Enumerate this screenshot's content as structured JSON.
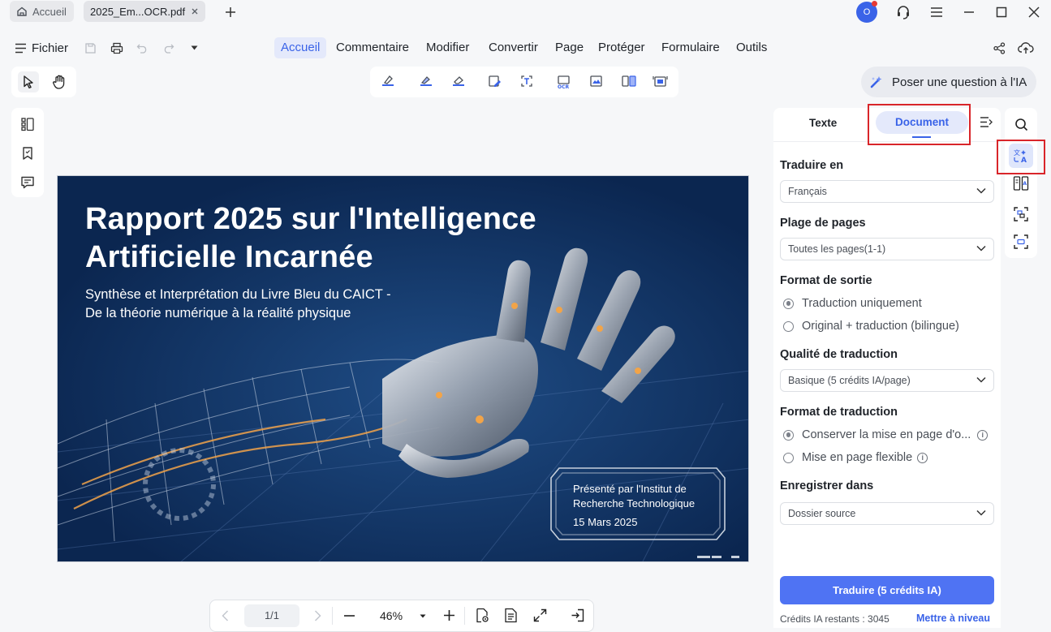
{
  "tabs": {
    "home_label": "Accueil",
    "doc_label": "2025_Em...OCR.pdf"
  },
  "titlebar": {
    "avatar_letter": "O",
    "accent": "#3a63e8"
  },
  "menubar": {
    "file_label": "Fichier",
    "items": [
      "Accueil",
      "Commentaire",
      "Modifier",
      "Convertir",
      "Page",
      "Protéger",
      "Formulaire",
      "Outils"
    ]
  },
  "ai": {
    "ask_label": "Poser une question à l'IA"
  },
  "document": {
    "title_line1": "Rapport 2025 sur l'Intelligence",
    "title_line2": "Artificielle Incarnée",
    "subtitle_line1": "Synthèse et Interprétation du Livre Bleu du CAICT -",
    "subtitle_line2": "De la théorie numérique à la réalité physique",
    "credit_line1": "Présenté par l'Institut de",
    "credit_line2": "Recherche Technologique",
    "credit_date": "15 Mars 2025"
  },
  "panel": {
    "tab_text": "Texte",
    "tab_document": "Document",
    "translate_to_label": "Traduire en",
    "translate_to_value": "Français",
    "page_range_label": "Plage de pages",
    "page_range_value": "Toutes les pages(1-1)",
    "output_format_label": "Format de sortie",
    "output_opt1": "Traduction uniquement",
    "output_opt2": "Original + traduction (bilingue)",
    "quality_label": "Qualité de traduction",
    "quality_value": "Basique (5 crédits IA/page)",
    "trans_format_label": "Format de traduction",
    "trans_opt1": "Conserver la mise en page d'o...",
    "trans_opt2": "Mise en page flexible",
    "save_in_label": "Enregistrer dans",
    "save_in_value": "Dossier source",
    "translate_button": "Traduire (5 crédits IA)",
    "credits_text": "Crédits IA restants : 3045",
    "upgrade_link": "Mettre à niveau"
  },
  "bottombar": {
    "page_indicator": "1/1",
    "zoom": "46%"
  }
}
